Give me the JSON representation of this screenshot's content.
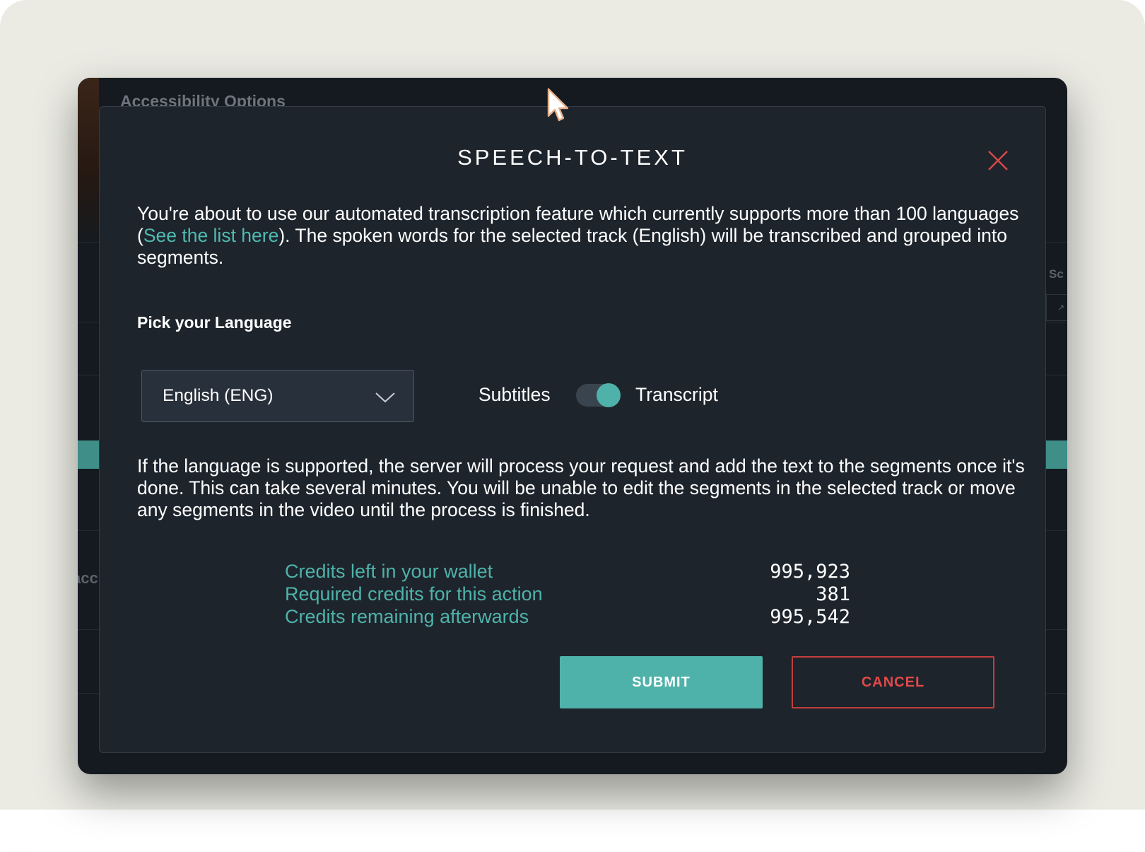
{
  "background": {
    "section_title": "Accessibility Options",
    "left_partial_text": "acc",
    "right_partial_text": "Sc"
  },
  "modal": {
    "title": "SPEECH-TO-TEXT",
    "intro_before_link": "You're about to use our automated transcription feature which currently supports more than 100 languages (",
    "intro_link": "See the list here",
    "intro_after_link": "). The spoken words for the selected track (English) will be transcribed and grouped into segments.",
    "pick_language_label": "Pick your Language",
    "language_select": {
      "selected_value": "English (ENG)"
    },
    "mode_toggle": {
      "left_label": "Subtitles",
      "right_label": "Transcript",
      "selected": "Transcript"
    },
    "notice": "If the language is supported, the server will process your request and add the text to the segments once it's done. This can take several minutes. You will be unable to edit the segments in the selected track or move any segments in the video until the process is finished.",
    "credits": [
      {
        "label": "Credits left in your wallet",
        "value": "995,923"
      },
      {
        "label": "Required credits for this action",
        "value": "381"
      },
      {
        "label": "Credits remaining afterwards",
        "value": "995,542"
      }
    ],
    "submit_label": "SUBMIT",
    "cancel_label": "CANCEL"
  },
  "colors": {
    "accent_teal": "#4fb2aa",
    "cancel_red": "#e04a4a",
    "modal_bg": "#1e242c",
    "page_bg": "#ebebe4"
  },
  "icons": {
    "close": "close-icon",
    "dropdown": "chevron-down-icon",
    "cursor": "mouse-cursor-icon"
  }
}
